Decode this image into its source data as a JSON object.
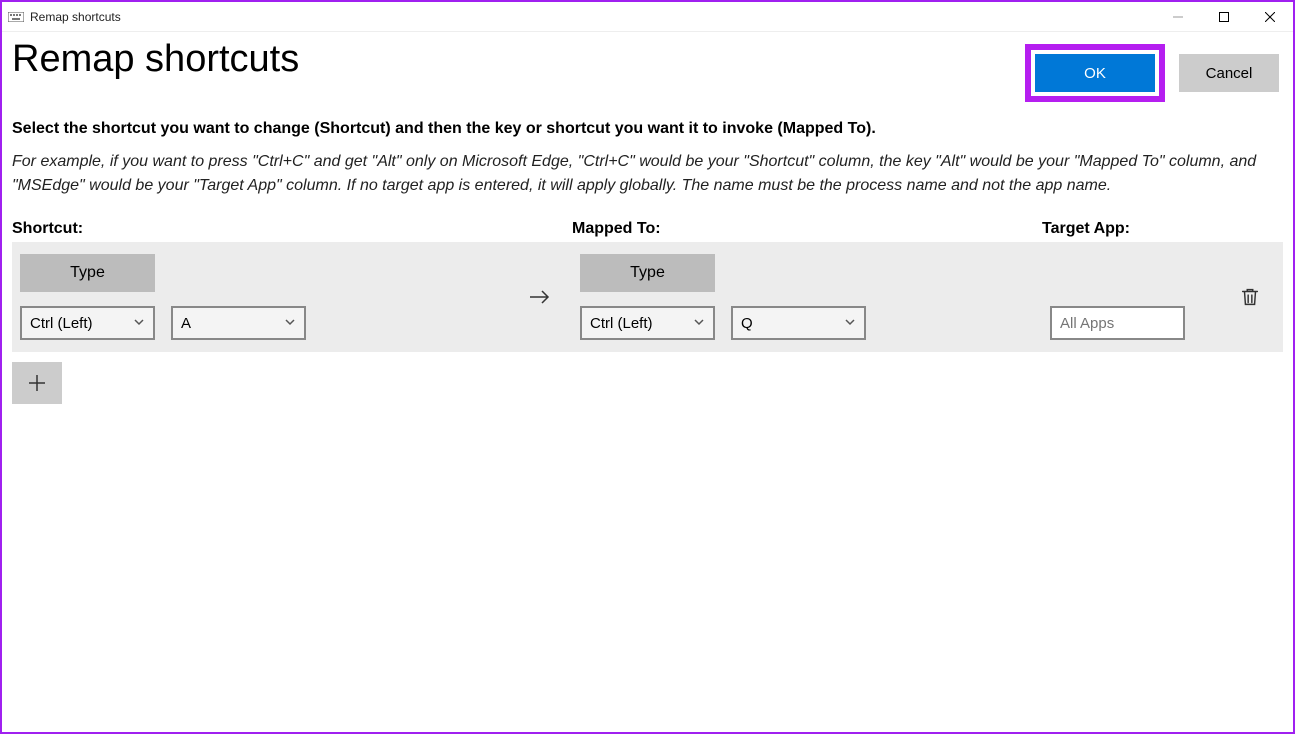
{
  "window": {
    "title": "Remap shortcuts"
  },
  "header": {
    "page_title": "Remap shortcuts",
    "ok_label": "OK",
    "cancel_label": "Cancel"
  },
  "instructions": {
    "main": "Select the shortcut you want to change (Shortcut) and then the key or shortcut you want it to invoke (Mapped To).",
    "example": "For example, if you want to press \"Ctrl+C\" and get \"Alt\" only on Microsoft Edge, \"Ctrl+C\" would be your \"Shortcut\" column, the key \"Alt\" would be your \"Mapped To\" column, and \"MSEdge\" would be your \"Target App\" column. If no target app is entered, it will apply globally. The name must be the process name and not the app name."
  },
  "columns": {
    "shortcut": "Shortcut:",
    "mapped_to": "Mapped To:",
    "target_app": "Target App:"
  },
  "row": {
    "type_label": "Type",
    "shortcut_key1": "Ctrl (Left)",
    "shortcut_key2": "A",
    "mapped_key1": "Ctrl (Left)",
    "mapped_key2": "Q",
    "target_placeholder": "All Apps"
  }
}
